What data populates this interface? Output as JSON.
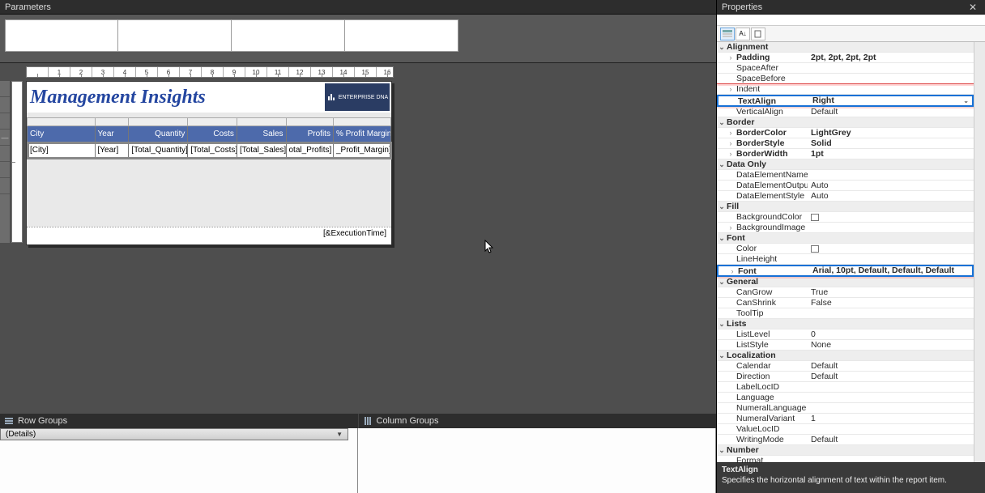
{
  "panels": {
    "parameters": "Parameters",
    "properties": "Properties",
    "rowGroups": "Row Groups",
    "columnGroups": "Column Groups"
  },
  "ruler": [
    "",
    "1",
    "2",
    "3",
    "4",
    "5",
    "6",
    "7",
    "8",
    "9",
    "10",
    "11",
    "12",
    "13",
    "14",
    "15",
    "16"
  ],
  "report": {
    "title": "Management Insights",
    "logoText": "ENTERPRISE DNA",
    "columns": {
      "city": "City",
      "year": "Year",
      "quantity": "Quantity",
      "costs": "Costs",
      "sales": "Sales",
      "profits": "Profits",
      "margin": "% Profit Margin"
    },
    "fields": {
      "city": "[City]",
      "year": "[Year]",
      "quantity": "[Total_Quantity]",
      "costs": "[Total_Costs]",
      "sales": "[Total_Sales]",
      "profits": "otal_Profits]",
      "margin": "_Profit_Margin]"
    },
    "footer": "[&ExecutionTime]"
  },
  "groups": {
    "details": "(Details)"
  },
  "props": {
    "cats": {
      "alignment": "Alignment",
      "border": "Border",
      "dataOnly": "Data Only",
      "fill": "Fill",
      "font": "Font",
      "general": "General",
      "lists": "Lists",
      "localization": "Localization",
      "number": "Number"
    },
    "alignment": {
      "padding": {
        "n": "Padding",
        "v": "2pt, 2pt, 2pt, 2pt"
      },
      "spaceAfter": {
        "n": "SpaceAfter",
        "v": ""
      },
      "spaceBefore": {
        "n": "SpaceBefore",
        "v": ""
      },
      "indent": {
        "n": "Indent",
        "v": ""
      },
      "textAlign": {
        "n": "TextAlign",
        "v": "Right"
      },
      "verticalAlign": {
        "n": "VerticalAlign",
        "v": "Default"
      }
    },
    "border": {
      "borderColor": {
        "n": "BorderColor",
        "v": "LightGrey"
      },
      "borderStyle": {
        "n": "BorderStyle",
        "v": "Solid"
      },
      "borderWidth": {
        "n": "BorderWidth",
        "v": "1pt"
      }
    },
    "dataOnly": {
      "dataElementName": {
        "n": "DataElementName",
        "v": ""
      },
      "dataElementOutput": {
        "n": "DataElementOutput",
        "v": "Auto"
      },
      "dataElementStyle": {
        "n": "DataElementStyle",
        "v": "Auto"
      }
    },
    "fill": {
      "backgroundColor": {
        "n": "BackgroundColor",
        "v": ""
      },
      "backgroundImage": {
        "n": "BackgroundImage",
        "v": ""
      }
    },
    "font": {
      "color": {
        "n": "Color",
        "v": ""
      },
      "lineHeight": {
        "n": "LineHeight",
        "v": ""
      },
      "font": {
        "n": "Font",
        "v": "Arial, 10pt, Default, Default, Default"
      }
    },
    "general": {
      "canGrow": {
        "n": "CanGrow",
        "v": "True"
      },
      "canShrink": {
        "n": "CanShrink",
        "v": "False"
      },
      "toolTip": {
        "n": "ToolTip",
        "v": ""
      }
    },
    "lists": {
      "listLevel": {
        "n": "ListLevel",
        "v": "0"
      },
      "listStyle": {
        "n": "ListStyle",
        "v": "None"
      }
    },
    "localization": {
      "calendar": {
        "n": "Calendar",
        "v": "Default"
      },
      "direction": {
        "n": "Direction",
        "v": "Default"
      },
      "labelLocID": {
        "n": "LabelLocID",
        "v": ""
      },
      "language": {
        "n": "Language",
        "v": ""
      },
      "numeralLanguage": {
        "n": "NumeralLanguage",
        "v": ""
      },
      "numeralVariant": {
        "n": "NumeralVariant",
        "v": "1"
      },
      "valueLocID": {
        "n": "ValueLocID",
        "v": ""
      },
      "writingMode": {
        "n": "WritingMode",
        "v": "Default"
      }
    },
    "number": {
      "format": {
        "n": "Format",
        "v": ""
      }
    }
  },
  "help": {
    "title": "TextAlign",
    "desc": "Specifies the horizontal alignment of text within the report item."
  }
}
